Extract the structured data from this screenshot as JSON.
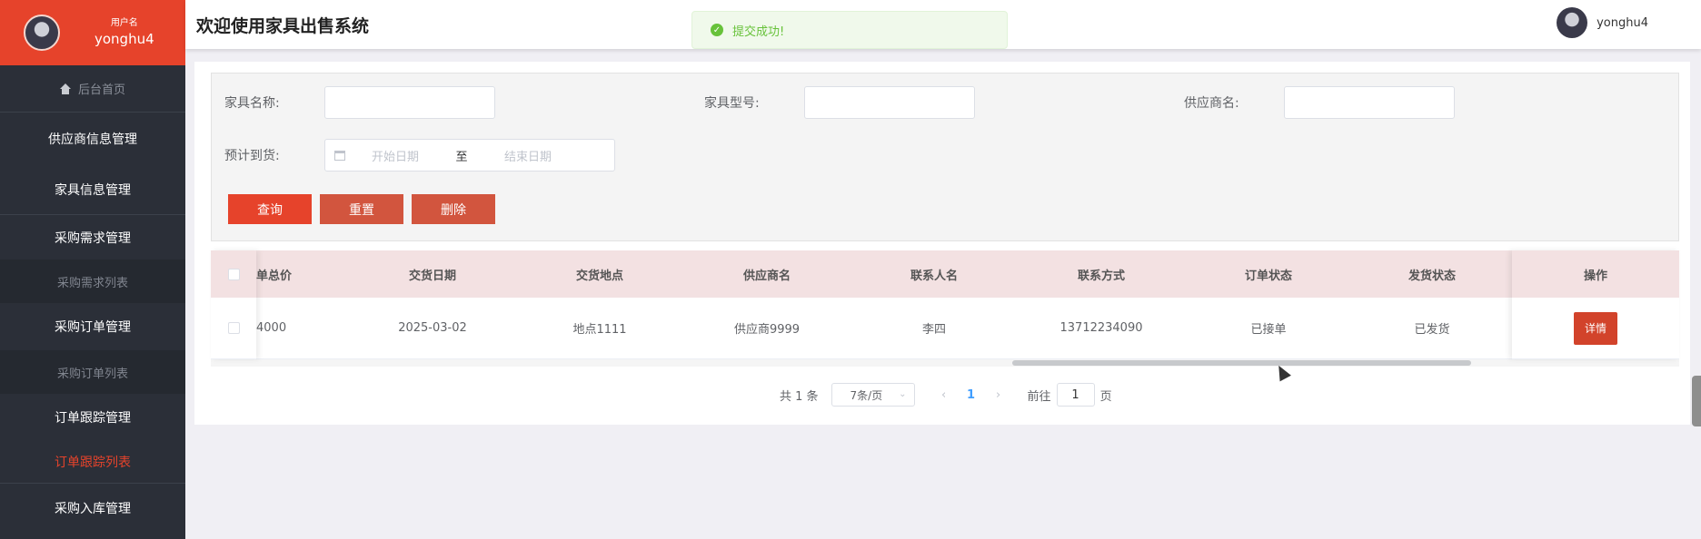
{
  "sidebar": {
    "user_label": "用户名",
    "user_name": "yonghu4",
    "home": "后台首页",
    "items": [
      {
        "label": "供应商信息管理"
      },
      {
        "label": "家具信息管理"
      },
      {
        "label": "采购需求管理"
      },
      {
        "label": "采购需求列表"
      },
      {
        "label": "采购订单管理"
      },
      {
        "label": "采购订单列表"
      },
      {
        "label": "订单跟踪管理"
      },
      {
        "label": "订单跟踪列表"
      },
      {
        "label": "采购入库管理"
      }
    ],
    "accent": "#e6432b"
  },
  "header": {
    "title": "欢迎使用家具出售系统",
    "user_name": "yonghu4"
  },
  "toast": {
    "message": "提交成功!",
    "color": "#67c23a"
  },
  "filter": {
    "name_label": "家具名称:",
    "model_label": "家具型号:",
    "supplier_label": "供应商名:",
    "arrival_label": "预计到货:",
    "start_placeholder": "开始日期",
    "range_separator": "至",
    "end_placeholder": "结束日期",
    "search_button": "查询",
    "reset_button": "重置",
    "delete_button": "删除"
  },
  "table": {
    "columns": [
      "单总价",
      "交货日期",
      "交货地点",
      "供应商名",
      "联系人名",
      "联系方式",
      "订单状态",
      "发货状态",
      "操作"
    ],
    "rows": [
      {
        "cells": [
          "4000",
          "2025-03-02",
          "地点1111",
          "供应商9999",
          "李四",
          "13712234090",
          "已接单",
          "已发货"
        ],
        "action": "详情"
      }
    ]
  },
  "pagination": {
    "total": "共 1 条",
    "page_size": "7条/页",
    "current_page": "1",
    "goto_label": "前往",
    "goto_value": "1",
    "page_suffix": "页"
  }
}
